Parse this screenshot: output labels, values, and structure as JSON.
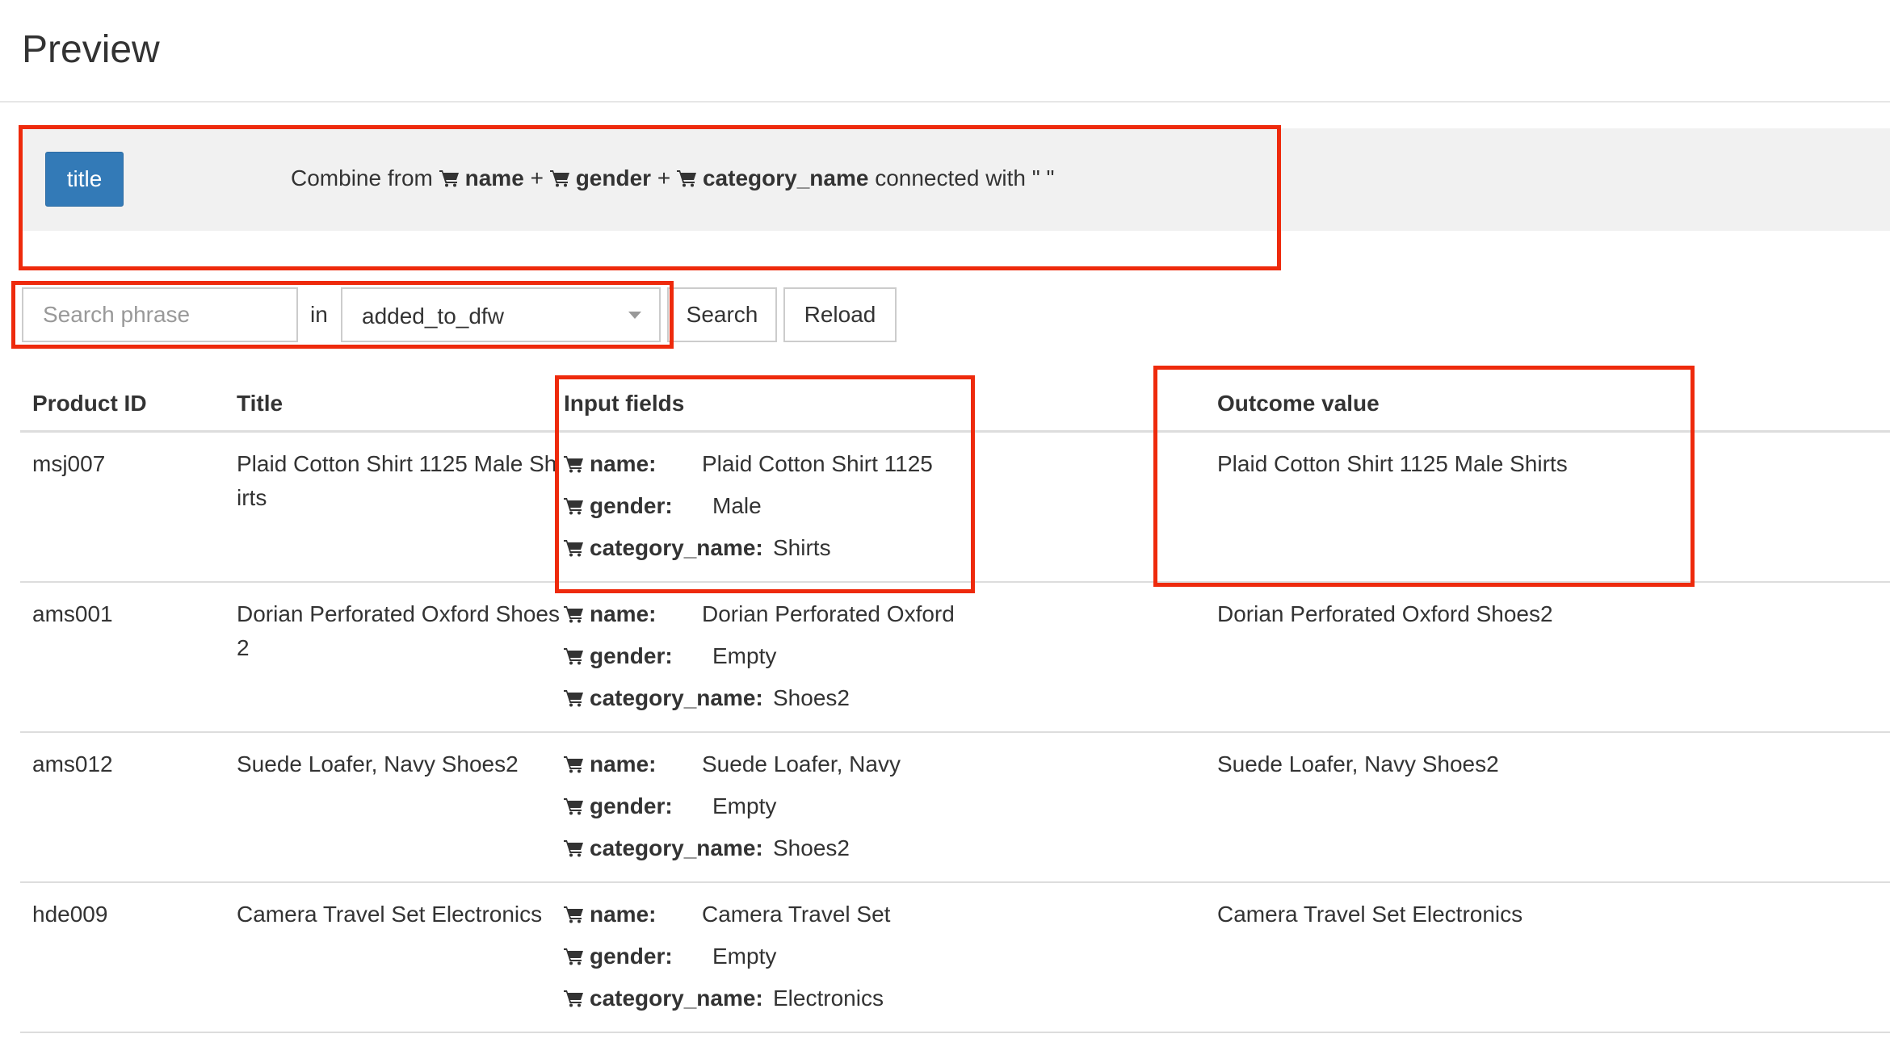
{
  "header": {
    "title": "Preview"
  },
  "rule": {
    "field_badge": "title",
    "prefix": "Combine from",
    "fields": [
      "name",
      "gender",
      "category_name"
    ],
    "plus": "+",
    "suffix": "connected with \" \""
  },
  "search": {
    "placeholder": "Search phrase",
    "in_label": "in",
    "scope_value": "added_to_dfw",
    "search_label": "Search",
    "reload_label": "Reload"
  },
  "table": {
    "columns": [
      "Product ID",
      "Title",
      "Input fields",
      "Outcome value"
    ],
    "field_labels": [
      "name:",
      "gender:",
      "category_name:"
    ],
    "rows": [
      {
        "id": "msj007",
        "title": "Plaid Cotton Shirt 1125 Male Shirts",
        "name": "Plaid Cotton Shirt 1125",
        "gender": "Male",
        "category_name": "Shirts",
        "outcome": "Plaid Cotton Shirt 1125 Male Shirts"
      },
      {
        "id": "ams001",
        "title": "Dorian Perforated Oxford Shoes2",
        "name": "Dorian Perforated Oxford",
        "gender": "Empty",
        "category_name": "Shoes2",
        "outcome": "Dorian Perforated Oxford Shoes2"
      },
      {
        "id": "ams012",
        "title": "Suede Loafer, Navy Shoes2",
        "name": "Suede Loafer, Navy",
        "gender": "Empty",
        "category_name": "Shoes2",
        "outcome": "Suede Loafer, Navy Shoes2"
      },
      {
        "id": "hde009",
        "title": "Camera Travel Set Electronics",
        "name": "Camera Travel Set",
        "gender": "Empty",
        "category_name": "Electronics",
        "outcome": "Camera Travel Set Electronics"
      }
    ]
  },
  "colors": {
    "primary": "#337ab7",
    "annotation": "#ee2a0c",
    "panel_bg": "#f1f1f1"
  },
  "icons": {
    "field_icon": "shopping-cart-icon"
  }
}
